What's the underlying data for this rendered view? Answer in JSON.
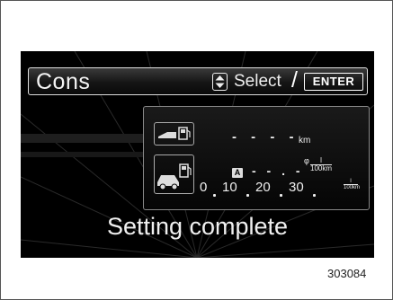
{
  "header": {
    "title": "Cons",
    "select_label": "Select",
    "slash": "/",
    "enter_label": "ENTER"
  },
  "panel": {
    "range_value": "- - - -",
    "range_unit": "km",
    "mode_badge": "A",
    "consumption_value": "- - . -",
    "consumption_unit_prefix": "φ",
    "consumption_unit_num": "l",
    "consumption_unit_den": "100km",
    "scale_ticks": [
      "0",
      "10",
      "20",
      "30"
    ],
    "scale_unit_num": "l",
    "scale_unit_den": "100km"
  },
  "status": {
    "message": "Setting complete"
  },
  "figure_code": "303084",
  "icons": [
    "up-down-arrow-icon",
    "range-fuel-pump-icon",
    "car-fuel-pump-icon"
  ],
  "colors": {
    "screen_background": "#000000",
    "text": "#f0f0f0",
    "page": "#ffffff"
  }
}
